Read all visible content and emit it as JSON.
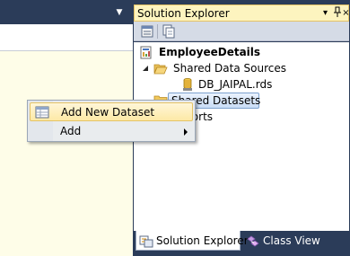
{
  "solution_explorer": {
    "title": "Solution Explorer",
    "pin_glyph": "▾",
    "autohide_glyph": "ᛘ",
    "close_glyph": "×",
    "toolbar": {
      "buttons": [
        {
          "name": "properties-icon"
        },
        {
          "name": "show-all-files-icon"
        }
      ]
    },
    "tree": {
      "project": {
        "label": "EmployeeDetails",
        "icon": "report-project-icon"
      },
      "shared_data_sources": {
        "label": "Shared Data Sources",
        "icon": "folder-open-icon",
        "expanded": true
      },
      "data_source_item": {
        "label": "DB_JAIPAL.rds",
        "icon": "data-source-icon"
      },
      "shared_datasets": {
        "label": "Shared Datasets",
        "icon": "folder-icon"
      },
      "reports": {
        "label": "Reports",
        "visible_label": "ports",
        "icon": "folder-icon"
      }
    }
  },
  "bottom_tabs": [
    {
      "label": "Solution Explorer",
      "active": true,
      "icon": "solution-explorer-icon"
    },
    {
      "label": "Class View",
      "active": false,
      "icon": "class-view-icon"
    }
  ],
  "context_menu": {
    "items": [
      {
        "label": "Add New Dataset",
        "icon": "dataset-icon",
        "highlighted": true
      },
      {
        "label": "Add",
        "has_submenu": true
      }
    ]
  },
  "editor": {
    "tab_dropdown_glyph": "▼"
  },
  "colors": {
    "frame": "#2b3c59",
    "title_bar": "#fdf4bf",
    "selection": "#c9ddf6",
    "menu_highlight": "#fde9a6",
    "editor_bg": "#fefde8"
  }
}
